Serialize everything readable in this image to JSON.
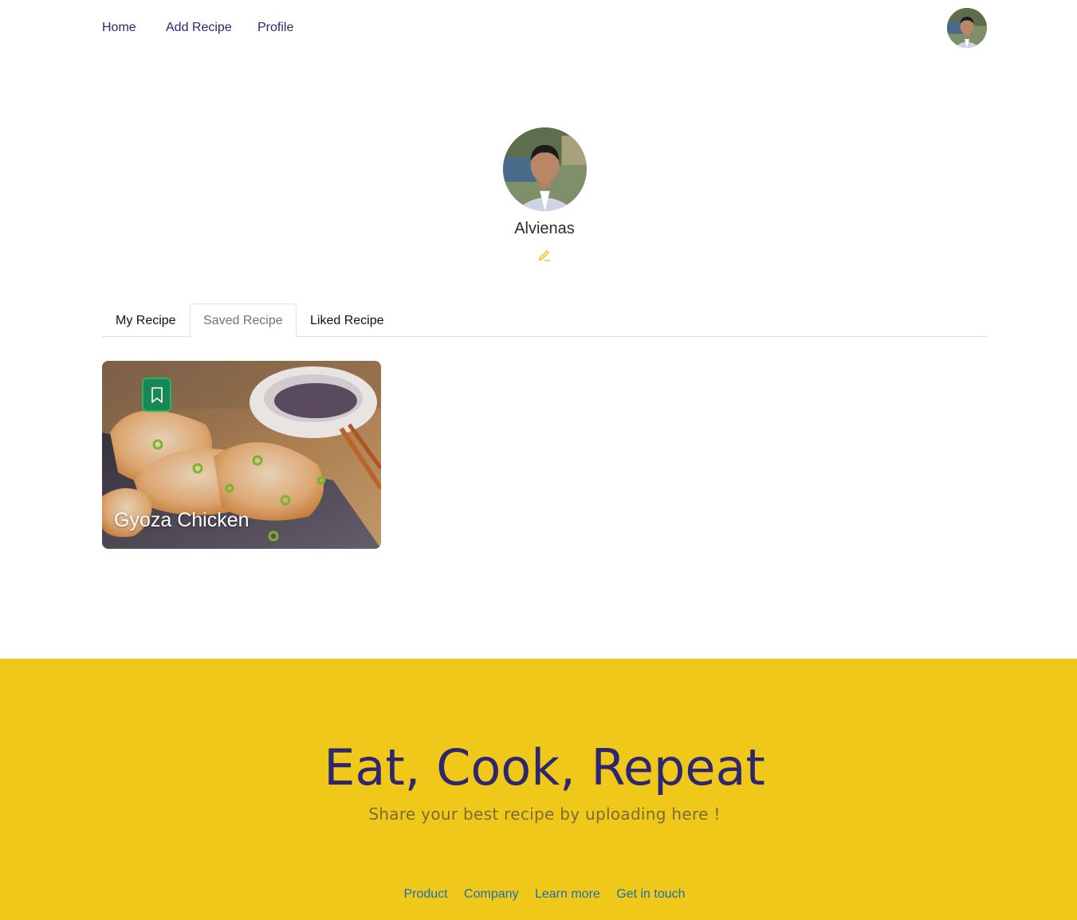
{
  "nav": {
    "home": "Home",
    "add_recipe": "Add Recipe",
    "profile": "Profile"
  },
  "profile": {
    "name": "Alvienas"
  },
  "tabs": [
    {
      "label": "My Recipe",
      "active": false
    },
    {
      "label": "Saved Recipe",
      "active": true
    },
    {
      "label": "Liked Recipe",
      "active": false
    }
  ],
  "recipes": [
    {
      "title": "Gyoza Chicken",
      "saved": true
    }
  ],
  "footer": {
    "title": "Eat, Cook, Repeat",
    "subtitle": "Share your best recipe by uploading here !",
    "links": [
      "Product",
      "Company",
      "Learn more",
      "Get in touch"
    ]
  },
  "colors": {
    "brand_navy": "#2e266f",
    "brand_yellow": "#efc81a",
    "save_green": "#198754",
    "link_blue": "#1b6fb5"
  },
  "icons": {
    "edit": "pencil-icon",
    "save": "bookmark-icon"
  }
}
